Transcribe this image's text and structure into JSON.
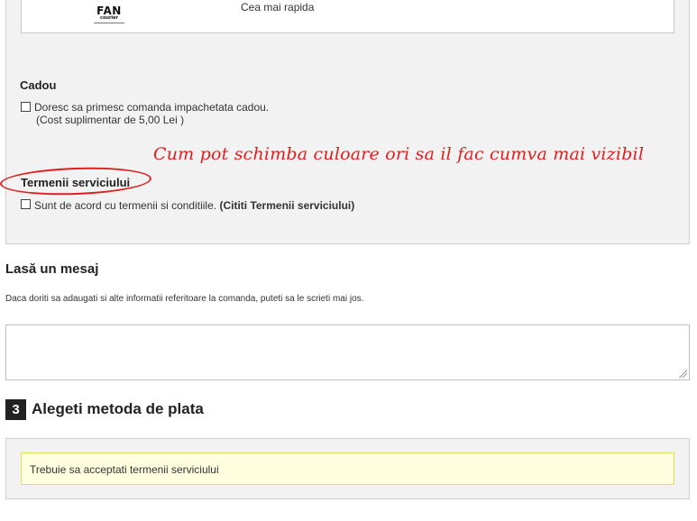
{
  "carrier": {
    "logo_text": "FAN",
    "logo_subtext": "courier",
    "speed_label": "Cea mai rapida"
  },
  "gift": {
    "title": "Cadou",
    "checkbox_label": "Doresc sa primesc comanda impachetata cadou.",
    "cost_note": "(Cost suplimentar de 5,00 Lei )",
    "checked": false
  },
  "annotation": {
    "text": "Cum pot schimba culoare ori sa il fac cumva mai vizibil",
    "color": "#e01e1e"
  },
  "terms": {
    "title": "Termenii serviciului",
    "checkbox_label": "Sunt de acord cu termenii si conditiile.",
    "link_label": "(Cititi Termenii serviciului)",
    "checked": false
  },
  "message": {
    "title": "Lasă un mesaj",
    "description": "Daca doriti sa adaugati si alte informatii referitoare la comanda, puteti sa le scrieti mai jos.",
    "value": ""
  },
  "payment": {
    "step_number": "3",
    "title": "Alegeti metoda de plata",
    "warning": "Trebuie sa acceptati termenii serviciului"
  }
}
